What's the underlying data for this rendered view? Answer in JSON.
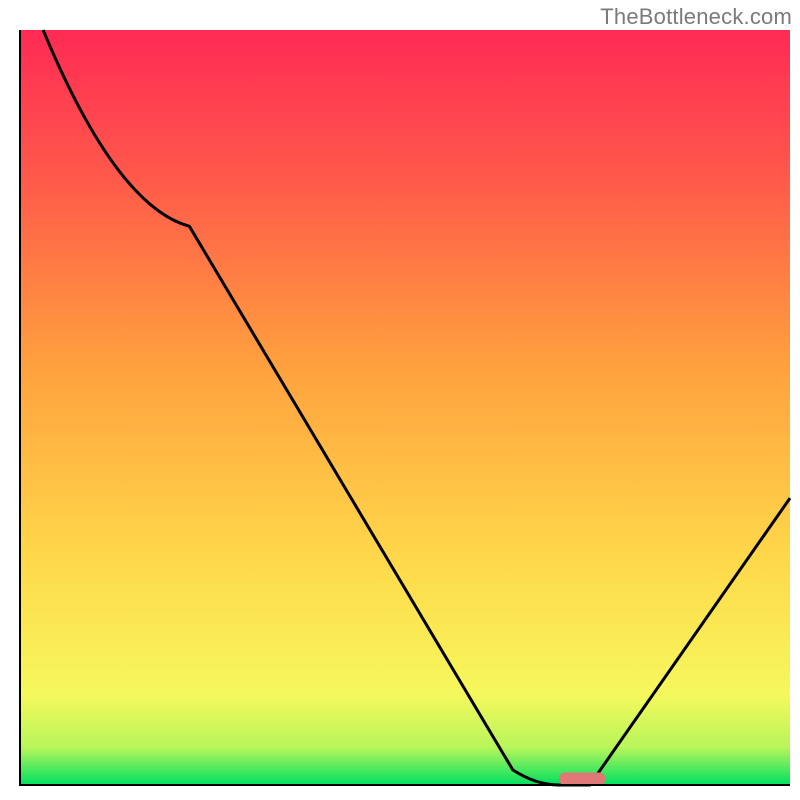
{
  "watermark": "TheBottleneck.com",
  "chart_data": {
    "type": "line",
    "title": "",
    "xlabel": "",
    "ylabel": "",
    "xlim": [
      0,
      100
    ],
    "ylim": [
      0,
      100
    ],
    "background": {
      "description": "vertical gradient mapping y (bottleneck magnitude) to color",
      "stops": [
        {
          "y": 0,
          "color": "#00e060"
        },
        {
          "y": 5,
          "color": "#b8f65a"
        },
        {
          "y": 12,
          "color": "#f5f85c"
        },
        {
          "y": 30,
          "color": "#ffd84a"
        },
        {
          "y": 55,
          "color": "#ffa23e"
        },
        {
          "y": 80,
          "color": "#ff5a4a"
        },
        {
          "y": 100,
          "color": "#ff2a55"
        }
      ]
    },
    "series": [
      {
        "name": "bottleneck-curve",
        "color": "#000000",
        "points": [
          {
            "x": 3,
            "y": 100
          },
          {
            "x": 22,
            "y": 74
          },
          {
            "x": 64,
            "y": 2
          },
          {
            "x": 70,
            "y": 0
          },
          {
            "x": 74,
            "y": 0
          },
          {
            "x": 100,
            "y": 38
          }
        ]
      }
    ],
    "annotations": [
      {
        "type": "capsule",
        "name": "optimal-marker",
        "x_start": 70,
        "x_end": 76,
        "y": 0.8,
        "color": "#e07878"
      }
    ],
    "axes": {
      "left_border": true,
      "bottom_border": true,
      "border_color": "#000000",
      "border_width": 2
    }
  }
}
